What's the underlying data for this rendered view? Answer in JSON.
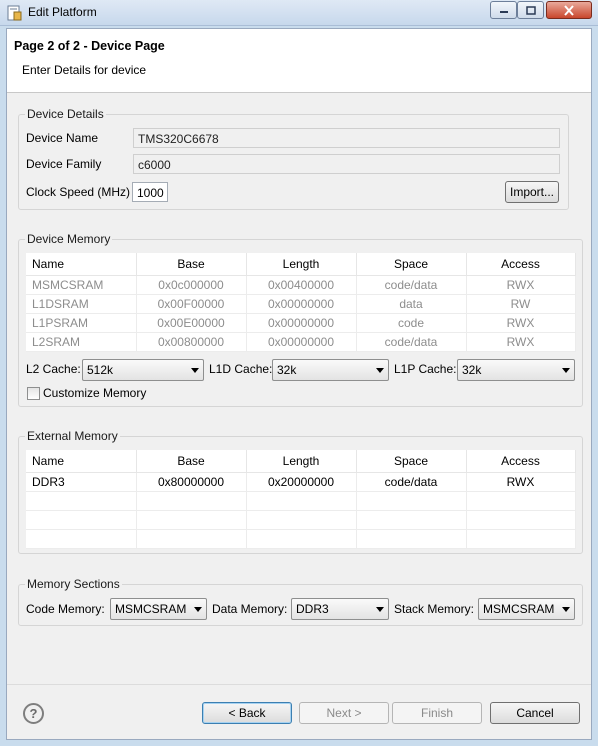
{
  "window": {
    "title": "Edit Platform"
  },
  "header": {
    "title": "Page 2 of 2 - Device Page",
    "description": "Enter Details for device"
  },
  "device_details": {
    "group_title": "Device Details",
    "name_label": "Device Name",
    "name_value": "TMS320C6678",
    "family_label": "Device Family",
    "family_value": "c6000",
    "clock_label": "Clock Speed (MHz)",
    "clock_value": "1000",
    "import_label": "Import..."
  },
  "device_memory": {
    "group_title": "Device Memory",
    "columns": [
      "Name",
      "Base",
      "Length",
      "Space",
      "Access"
    ],
    "rows": [
      [
        "MSMCSRAM",
        "0x0c000000",
        "0x00400000",
        "code/data",
        "RWX"
      ],
      [
        "L1DSRAM",
        "0x00F00000",
        "0x00000000",
        "data",
        "RW"
      ],
      [
        "L1PSRAM",
        "0x00E00000",
        "0x00000000",
        "code",
        "RWX"
      ],
      [
        "L2SRAM",
        "0x00800000",
        "0x00000000",
        "code/data",
        "RWX"
      ]
    ],
    "l2_label": "L2 Cache:",
    "l2_value": "512k",
    "l1d_label": "L1D Cache:",
    "l1d_value": "32k",
    "l1p_label": "L1P Cache:",
    "l1p_value": "32k",
    "customize_label": "Customize Memory"
  },
  "external_memory": {
    "group_title": "External Memory",
    "columns": [
      "Name",
      "Base",
      "Length",
      "Space",
      "Access"
    ],
    "rows": [
      [
        "DDR3",
        "0x80000000",
        "0x20000000",
        "code/data",
        "RWX"
      ],
      [
        "",
        "",
        "",
        "",
        ""
      ],
      [
        "",
        "",
        "",
        "",
        ""
      ],
      [
        "",
        "",
        "",
        "",
        ""
      ]
    ]
  },
  "memory_sections": {
    "group_title": "Memory Sections",
    "code_label": "Code Memory:",
    "code_value": "MSMCSRAM",
    "data_label": "Data Memory:",
    "data_value": "DDR3",
    "stack_label": "Stack Memory:",
    "stack_value": "MSMCSRAM"
  },
  "footer": {
    "help_glyph": "?",
    "back": "< Back",
    "next": "Next >",
    "finish": "Finish",
    "cancel": "Cancel"
  },
  "icons": {
    "app": "platform-icon",
    "help": "help-icon"
  }
}
